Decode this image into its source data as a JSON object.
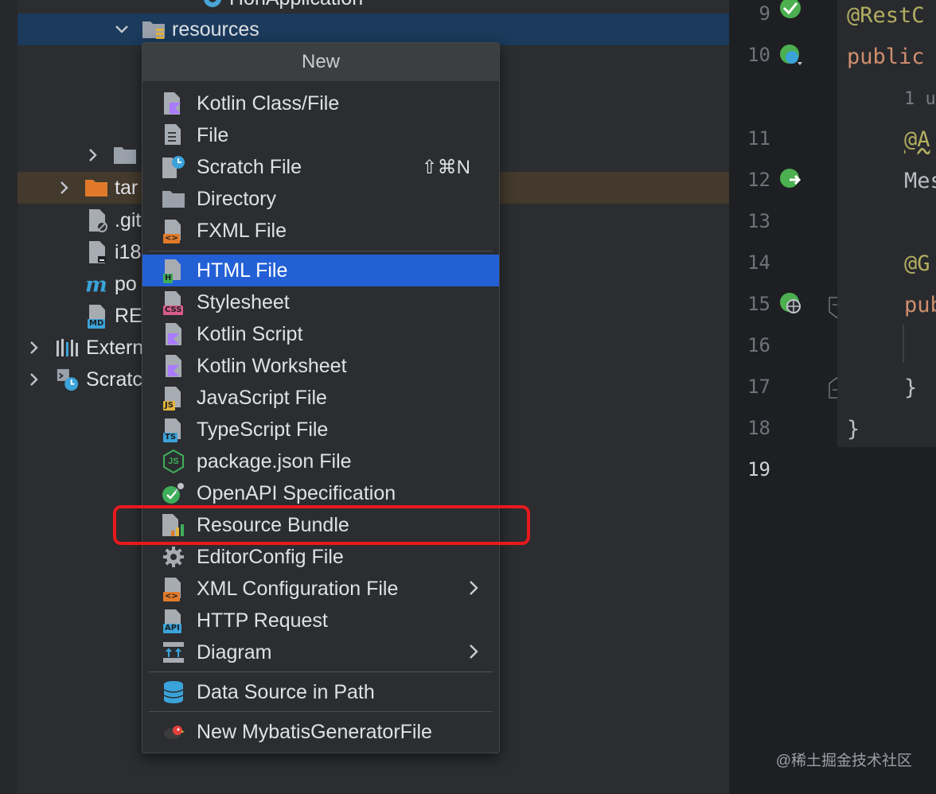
{
  "tree": {
    "items": [
      {
        "label": "HonApplication",
        "partial": true
      },
      {
        "label": "resources"
      },
      {
        "label": ""
      },
      {
        "label": "tar"
      },
      {
        "label": ".git"
      },
      {
        "label": "i18"
      },
      {
        "label": "po"
      },
      {
        "label": "RE"
      },
      {
        "label": "Extern"
      },
      {
        "label": "Scratc"
      }
    ]
  },
  "menu": {
    "title": "New",
    "items": [
      {
        "label": "Kotlin Class/File",
        "icon": "kotlin-file-icon"
      },
      {
        "label": "File",
        "icon": "file-icon"
      },
      {
        "label": "Scratch File",
        "icon": "scratch-file-icon",
        "shortcut": "⇧⌘N"
      },
      {
        "label": "Directory",
        "icon": "folder-icon"
      },
      {
        "label": "FXML File",
        "icon": "fxml-file-icon"
      },
      {
        "label": "HTML File",
        "icon": "html-file-icon"
      },
      {
        "label": "Stylesheet",
        "icon": "css-file-icon"
      },
      {
        "label": "Kotlin Script",
        "icon": "kotlin-script-icon"
      },
      {
        "label": "Kotlin Worksheet",
        "icon": "kotlin-worksheet-icon"
      },
      {
        "label": "JavaScript File",
        "icon": "javascript-file-icon"
      },
      {
        "label": "TypeScript File",
        "icon": "typescript-file-icon"
      },
      {
        "label": "package.json File",
        "icon": "nodejs-icon"
      },
      {
        "label": "OpenAPI Specification",
        "icon": "openapi-icon"
      },
      {
        "label": "Resource Bundle",
        "icon": "resource-bundle-icon"
      },
      {
        "label": "EditorConfig File",
        "icon": "gear-icon"
      },
      {
        "label": "XML Configuration File",
        "icon": "xml-file-icon"
      },
      {
        "label": "HTTP Request",
        "icon": "api-file-icon"
      },
      {
        "label": "Diagram",
        "icon": "diagram-icon"
      },
      {
        "label": "Data Source in Path",
        "icon": "database-icon"
      },
      {
        "label": "New MybatisGeneratorFile",
        "icon": "mybatis-bird-icon"
      }
    ],
    "selected": "HTML File",
    "highlighted": "Resource Bundle",
    "badges": {
      "fxml": "<>",
      "html": "H",
      "css": "CSS",
      "js": "JS",
      "ts": "TS",
      "xml": "<>",
      "api": "API",
      "md": "MD",
      "nodejs": "JS"
    }
  },
  "gutter": {
    "line_numbers": [
      "9",
      "10",
      "11",
      "12",
      "13",
      "14",
      "15",
      "16",
      "17",
      "18",
      "19"
    ]
  },
  "editor": {
    "lines": [
      "@RestC",
      "public",
      "1 u",
      "@A",
      "Mes",
      "@G",
      "pub",
      "}",
      "}"
    ]
  },
  "watermark": "@稀土掘金技术社区",
  "colors": {
    "selection": "#2360d6",
    "highlight_box": "#e8191c",
    "tree_selection": "#1b3a5c"
  }
}
